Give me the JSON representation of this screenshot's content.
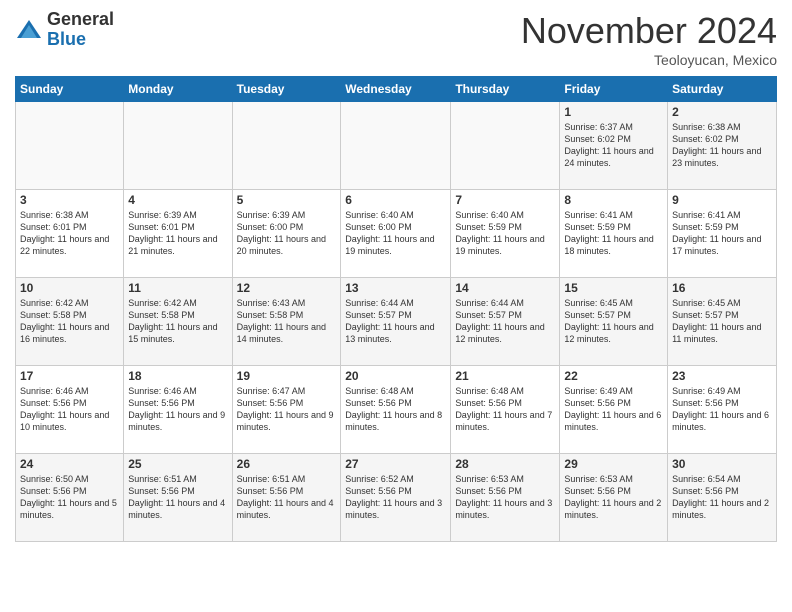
{
  "header": {
    "logo": {
      "general": "General",
      "blue": "Blue"
    },
    "title": "November 2024",
    "location": "Teoloyucan, Mexico"
  },
  "days": [
    "Sunday",
    "Monday",
    "Tuesday",
    "Wednesday",
    "Thursday",
    "Friday",
    "Saturday"
  ],
  "weeks": [
    [
      {
        "day": "",
        "info": ""
      },
      {
        "day": "",
        "info": ""
      },
      {
        "day": "",
        "info": ""
      },
      {
        "day": "",
        "info": ""
      },
      {
        "day": "",
        "info": ""
      },
      {
        "day": "1",
        "info": "Sunrise: 6:37 AM\nSunset: 6:02 PM\nDaylight: 11 hours and 24 minutes."
      },
      {
        "day": "2",
        "info": "Sunrise: 6:38 AM\nSunset: 6:02 PM\nDaylight: 11 hours and 23 minutes."
      }
    ],
    [
      {
        "day": "3",
        "info": "Sunrise: 6:38 AM\nSunset: 6:01 PM\nDaylight: 11 hours and 22 minutes."
      },
      {
        "day": "4",
        "info": "Sunrise: 6:39 AM\nSunset: 6:01 PM\nDaylight: 11 hours and 21 minutes."
      },
      {
        "day": "5",
        "info": "Sunrise: 6:39 AM\nSunset: 6:00 PM\nDaylight: 11 hours and 20 minutes."
      },
      {
        "day": "6",
        "info": "Sunrise: 6:40 AM\nSunset: 6:00 PM\nDaylight: 11 hours and 19 minutes."
      },
      {
        "day": "7",
        "info": "Sunrise: 6:40 AM\nSunset: 5:59 PM\nDaylight: 11 hours and 19 minutes."
      },
      {
        "day": "8",
        "info": "Sunrise: 6:41 AM\nSunset: 5:59 PM\nDaylight: 11 hours and 18 minutes."
      },
      {
        "day": "9",
        "info": "Sunrise: 6:41 AM\nSunset: 5:59 PM\nDaylight: 11 hours and 17 minutes."
      }
    ],
    [
      {
        "day": "10",
        "info": "Sunrise: 6:42 AM\nSunset: 5:58 PM\nDaylight: 11 hours and 16 minutes."
      },
      {
        "day": "11",
        "info": "Sunrise: 6:42 AM\nSunset: 5:58 PM\nDaylight: 11 hours and 15 minutes."
      },
      {
        "day": "12",
        "info": "Sunrise: 6:43 AM\nSunset: 5:58 PM\nDaylight: 11 hours and 14 minutes."
      },
      {
        "day": "13",
        "info": "Sunrise: 6:44 AM\nSunset: 5:57 PM\nDaylight: 11 hours and 13 minutes."
      },
      {
        "day": "14",
        "info": "Sunrise: 6:44 AM\nSunset: 5:57 PM\nDaylight: 11 hours and 12 minutes."
      },
      {
        "day": "15",
        "info": "Sunrise: 6:45 AM\nSunset: 5:57 PM\nDaylight: 11 hours and 12 minutes."
      },
      {
        "day": "16",
        "info": "Sunrise: 6:45 AM\nSunset: 5:57 PM\nDaylight: 11 hours and 11 minutes."
      }
    ],
    [
      {
        "day": "17",
        "info": "Sunrise: 6:46 AM\nSunset: 5:56 PM\nDaylight: 11 hours and 10 minutes."
      },
      {
        "day": "18",
        "info": "Sunrise: 6:46 AM\nSunset: 5:56 PM\nDaylight: 11 hours and 9 minutes."
      },
      {
        "day": "19",
        "info": "Sunrise: 6:47 AM\nSunset: 5:56 PM\nDaylight: 11 hours and 9 minutes."
      },
      {
        "day": "20",
        "info": "Sunrise: 6:48 AM\nSunset: 5:56 PM\nDaylight: 11 hours and 8 minutes."
      },
      {
        "day": "21",
        "info": "Sunrise: 6:48 AM\nSunset: 5:56 PM\nDaylight: 11 hours and 7 minutes."
      },
      {
        "day": "22",
        "info": "Sunrise: 6:49 AM\nSunset: 5:56 PM\nDaylight: 11 hours and 6 minutes."
      },
      {
        "day": "23",
        "info": "Sunrise: 6:49 AM\nSunset: 5:56 PM\nDaylight: 11 hours and 6 minutes."
      }
    ],
    [
      {
        "day": "24",
        "info": "Sunrise: 6:50 AM\nSunset: 5:56 PM\nDaylight: 11 hours and 5 minutes."
      },
      {
        "day": "25",
        "info": "Sunrise: 6:51 AM\nSunset: 5:56 PM\nDaylight: 11 hours and 4 minutes."
      },
      {
        "day": "26",
        "info": "Sunrise: 6:51 AM\nSunset: 5:56 PM\nDaylight: 11 hours and 4 minutes."
      },
      {
        "day": "27",
        "info": "Sunrise: 6:52 AM\nSunset: 5:56 PM\nDaylight: 11 hours and 3 minutes."
      },
      {
        "day": "28",
        "info": "Sunrise: 6:53 AM\nSunset: 5:56 PM\nDaylight: 11 hours and 3 minutes."
      },
      {
        "day": "29",
        "info": "Sunrise: 6:53 AM\nSunset: 5:56 PM\nDaylight: 11 hours and 2 minutes."
      },
      {
        "day": "30",
        "info": "Sunrise: 6:54 AM\nSunset: 5:56 PM\nDaylight: 11 hours and 2 minutes."
      }
    ]
  ]
}
